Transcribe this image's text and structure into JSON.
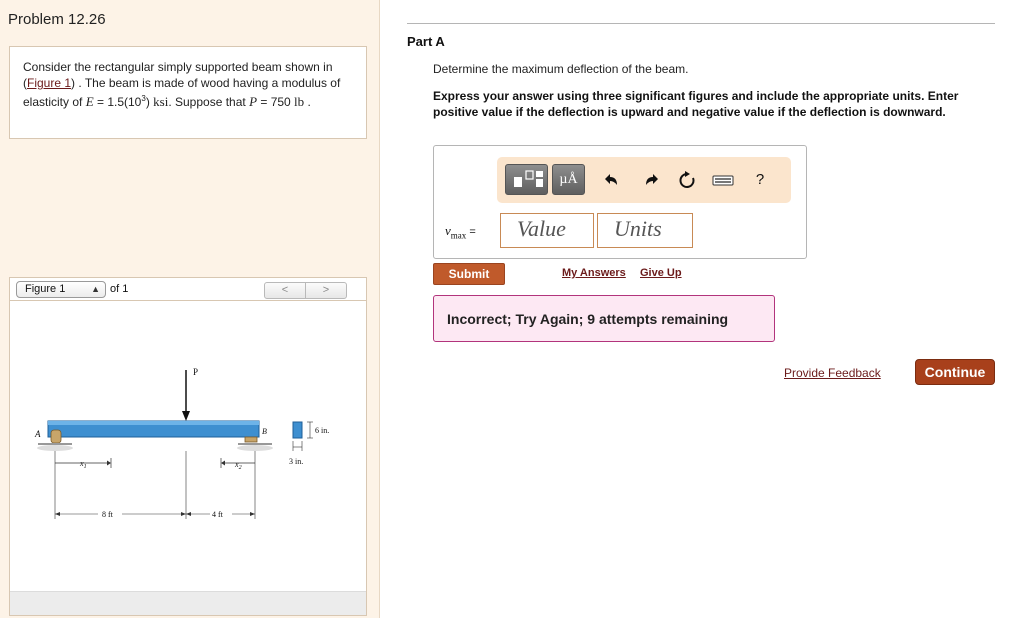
{
  "problem": {
    "title": "Problem 12.26",
    "text_1": "Consider the rectangular simply supported beam shown in (",
    "figure_link": "Figure 1",
    "text_2": ") . The beam is made of wood having a modulus of elasticity of ",
    "E_symbol": "E",
    "E_value": " = 1.5(10",
    "E_exp": "3",
    "E_close": ") ",
    "E_unit": "ksi",
    "text_3": ". Suppose that ",
    "P_symbol": "P",
    "P_value": " = 750 ",
    "P_unit": "lb",
    "text_end": " ."
  },
  "figure_nav": {
    "select_value": "Figure 1",
    "of_label": "of 1",
    "prev": "<",
    "next": ">"
  },
  "figure": {
    "label_P": "P",
    "label_A": "A",
    "label_B": "B",
    "label_x1": "x",
    "label_x1_sub": "1",
    "label_x2": "x",
    "label_x2_sub": "2",
    "label_8ft": "8 ft",
    "label_4ft": "4 ft",
    "label_6in": "6 in.",
    "label_3in": "3 in.",
    "colors": {
      "beam": "#3e8fd0",
      "beam_dark": "#1f5f99",
      "support": "#c8a56a"
    }
  },
  "part": {
    "title": "Part A",
    "question": "Determine the maximum deflection of the beam.",
    "instructions": "Express your answer using three significant figures and include the appropriate units. Enter positive value if the deflection is upward and negative value if the deflection is downward."
  },
  "answer": {
    "var_main": "v",
    "var_sub": "max",
    "var_eq": " =",
    "value_placeholder": "Value",
    "units_placeholder": "Units"
  },
  "toolbar": {
    "units_symbol": "µÅ",
    "undo_icon": "undo-icon",
    "redo_icon": "redo-icon",
    "reset_icon": "reset-icon",
    "keyboard_icon": "keyboard-icon",
    "help": "?"
  },
  "actions": {
    "submit": "Submit",
    "my_answers": "My Answers",
    "give_up": "Give Up"
  },
  "feedback": {
    "message": "Incorrect; Try Again; 9 attempts remaining"
  },
  "footer": {
    "provide_feedback": "Provide Feedback",
    "continue": "Continue"
  }
}
